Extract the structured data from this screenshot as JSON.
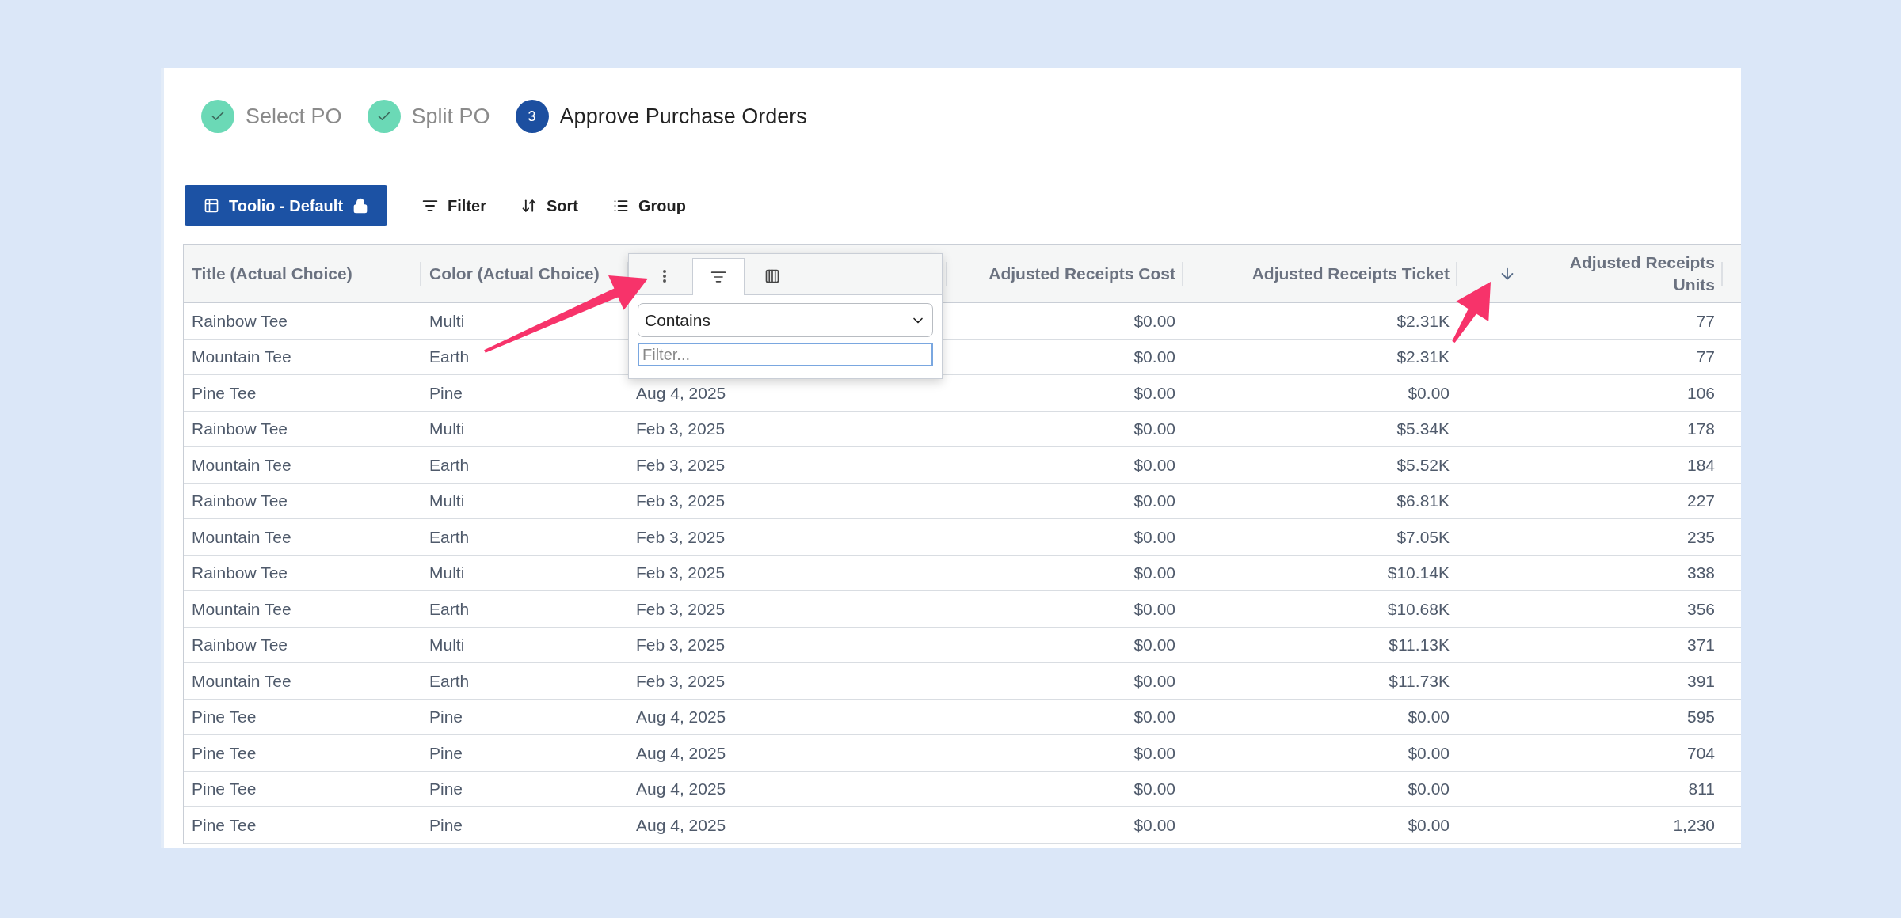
{
  "steps": [
    {
      "label": "Select PO",
      "completed": true,
      "selected": false
    },
    {
      "label": "Split PO",
      "completed": true,
      "selected": false
    },
    {
      "label": "Approve Purchase Orders",
      "completed": false,
      "selected": true,
      "number": "3"
    }
  ],
  "toolbar": {
    "view_button": "Toolio - Default",
    "locked": true,
    "actions": [
      {
        "label": "Filter",
        "kind": "filter"
      },
      {
        "label": "Sort",
        "kind": "sort"
      },
      {
        "label": "Group",
        "kind": "group"
      }
    ]
  },
  "table": {
    "columns": [
      {
        "label": "Title (Actual Choice)",
        "kind": "text"
      },
      {
        "label": "Color (Actual Choice)",
        "kind": "text"
      },
      {
        "kind": "text"
      },
      {
        "label": "Adjusted Receipts Cost",
        "kind": "number"
      },
      {
        "label": "Adjusted Receipts Ticket",
        "kind": "number"
      },
      {
        "label": "Adjusted Receipts Units",
        "kind": "number",
        "sorted_descending": true
      }
    ],
    "rows": [
      {
        "cells": [
          "Rainbow Tee",
          "Multi",
          null,
          "$0.00",
          "$2.31K",
          "77"
        ]
      },
      {
        "cells": [
          "Mountain Tee",
          "Earth",
          null,
          "$0.00",
          "$2.31K",
          "77"
        ]
      },
      {
        "cells": [
          "Pine Tee",
          "Pine",
          "Aug 4, 2025",
          "$0.00",
          "$0.00",
          "106"
        ]
      },
      {
        "cells": [
          "Rainbow Tee",
          "Multi",
          "Feb 3, 2025",
          "$0.00",
          "$5.34K",
          "178"
        ]
      },
      {
        "cells": [
          "Mountain Tee",
          "Earth",
          "Feb 3, 2025",
          "$0.00",
          "$5.52K",
          "184"
        ]
      },
      {
        "cells": [
          "Rainbow Tee",
          "Multi",
          "Feb 3, 2025",
          "$0.00",
          "$6.81K",
          "227"
        ]
      },
      {
        "cells": [
          "Mountain Tee",
          "Earth",
          "Feb 3, 2025",
          "$0.00",
          "$7.05K",
          "235"
        ]
      },
      {
        "cells": [
          "Rainbow Tee",
          "Multi",
          "Feb 3, 2025",
          "$0.00",
          "$10.14K",
          "338"
        ]
      },
      {
        "cells": [
          "Mountain Tee",
          "Earth",
          "Feb 3, 2025",
          "$0.00",
          "$10.68K",
          "356"
        ]
      },
      {
        "cells": [
          "Rainbow Tee",
          "Multi",
          "Feb 3, 2025",
          "$0.00",
          "$11.13K",
          "371"
        ]
      },
      {
        "cells": [
          "Mountain Tee",
          "Earth",
          "Feb 3, 2025",
          "$0.00",
          "$11.73K",
          "391"
        ]
      },
      {
        "cells": [
          "Pine Tee",
          "Pine",
          "Aug 4, 2025",
          "$0.00",
          "$0.00",
          "595"
        ]
      },
      {
        "cells": [
          "Pine Tee",
          "Pine",
          "Aug 4, 2025",
          "$0.00",
          "$0.00",
          "704"
        ]
      },
      {
        "cells": [
          "Pine Tee",
          "Pine",
          "Aug 4, 2025",
          "$0.00",
          "$0.00",
          "811"
        ]
      },
      {
        "cells": [
          "Pine Tee",
          "Pine",
          "Aug 4, 2025",
          "$0.00",
          "$0.00",
          "1,230"
        ]
      }
    ]
  },
  "column_menu": {
    "tabs": [
      {
        "kind": "menu",
        "selected": false
      },
      {
        "kind": "filter",
        "selected": true
      },
      {
        "kind": "columns",
        "selected": false
      }
    ],
    "operator": "Contains",
    "filter_placeholder": "Filter..."
  },
  "annotations": [
    {
      "kind": "arrow"
    },
    {
      "kind": "arrow"
    }
  ]
}
